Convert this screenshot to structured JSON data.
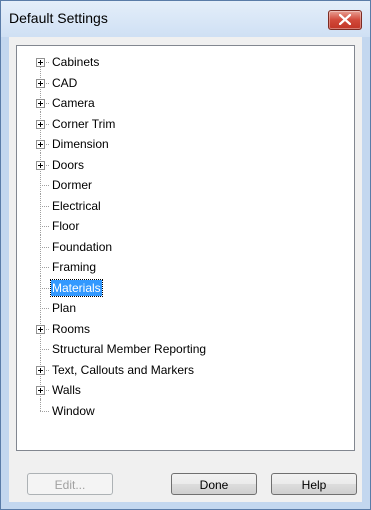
{
  "window": {
    "title": "Default Settings"
  },
  "tree": {
    "items": [
      {
        "label": "Cabinets",
        "expandable": true
      },
      {
        "label": "CAD",
        "expandable": true
      },
      {
        "label": "Camera",
        "expandable": true
      },
      {
        "label": "Corner Trim",
        "expandable": true
      },
      {
        "label": "Dimension",
        "expandable": true
      },
      {
        "label": "Doors",
        "expandable": true
      },
      {
        "label": "Dormer",
        "expandable": false
      },
      {
        "label": "Electrical",
        "expandable": false
      },
      {
        "label": "Floor",
        "expandable": false
      },
      {
        "label": "Foundation",
        "expandable": false
      },
      {
        "label": "Framing",
        "expandable": false
      },
      {
        "label": "Materials",
        "expandable": false,
        "selected": true
      },
      {
        "label": "Plan",
        "expandable": false
      },
      {
        "label": "Rooms",
        "expandable": true
      },
      {
        "label": "Structural Member Reporting",
        "expandable": false
      },
      {
        "label": "Text, Callouts and Markers",
        "expandable": true
      },
      {
        "label": "Walls",
        "expandable": true
      },
      {
        "label": "Window",
        "expandable": false
      }
    ]
  },
  "buttons": {
    "edit": "Edit...",
    "done": "Done",
    "help": "Help"
  },
  "colors": {
    "selection": "#3399ff",
    "close_button": "#c13526"
  }
}
